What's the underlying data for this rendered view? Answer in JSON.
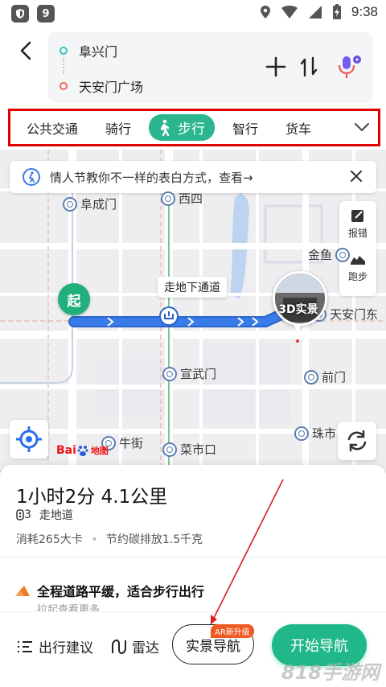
{
  "status_bar": {
    "time": "9:38",
    "left_icons": [
      "shield-icon",
      "app-9-icon"
    ],
    "right_icons": [
      "location-icon",
      "wifi-icon",
      "signal-icon",
      "battery-charging-icon"
    ]
  },
  "route": {
    "origin": "阜兴门",
    "destination": "天安门广场"
  },
  "modes": {
    "items": [
      "公共交通",
      "骑行",
      "步行",
      "智行",
      "货车"
    ],
    "active": "步行"
  },
  "tip": {
    "text": "情人节教你不一样的表白方式，查看→"
  },
  "side_tools": {
    "report": "报错",
    "run": "跑步"
  },
  "map": {
    "places": {
      "fuchengmen": "阜成门",
      "xisi": "西四",
      "jinyu": "金鱼",
      "tiananmen_east": "天安门东",
      "xuanwumen": "宣武门",
      "qianmen": "前门",
      "niujie": "牛街",
      "caishikou": "菜市口",
      "zhushi": "珠市"
    },
    "start_label": "起",
    "underpass_label": "走地下通道",
    "ar_label": "3D实景",
    "logo_bai": "Bai",
    "logo_du": "du",
    "logo_ditu": "地图",
    "colors": {
      "route": "#3a7bea",
      "start": "#21b07c"
    }
  },
  "summary": {
    "time_distance": "1小时2分  4.1公里",
    "lights": "3",
    "underpass": "走地道",
    "calories": "消耗265大卡",
    "sep": "•",
    "carbon": "节约碳排放1.5千克"
  },
  "advice": {
    "title": "全程道路平缓，适合步行出行",
    "sub": "拉起查看更多"
  },
  "bottom": {
    "travel_advice": "出行建议",
    "radar": "雷达",
    "ar_nav": "实景导航",
    "ar_badge": "AR新升级",
    "start_nav": "开始导航",
    "accent": "#20b888"
  },
  "watermark": "818手游网"
}
